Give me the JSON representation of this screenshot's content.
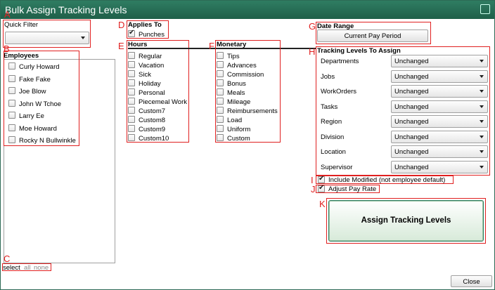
{
  "window": {
    "title": "Bulk Assign Tracking Levels"
  },
  "markers": {
    "A": "A",
    "B": "B",
    "C": "C",
    "D": "D",
    "E": "E",
    "F": "F",
    "G": "G",
    "H": "H",
    "I": "I",
    "J": "J",
    "K": "K"
  },
  "quick_filter": {
    "label": "Quick Filter",
    "value": ""
  },
  "employees": {
    "label": "Employees",
    "items": [
      "Curly Howard",
      "Fake Fake",
      "Joe Blow",
      "John W Tchoe",
      "Larry Ee",
      "Moe Howard",
      "Rocky N Bullwinkle"
    ]
  },
  "select_links": {
    "label": "select",
    "all": "all",
    "none": "none"
  },
  "applies_to": {
    "label": "Applies To",
    "punches": "Punches",
    "punches_checked": true
  },
  "hours": {
    "label": "Hours",
    "items": [
      "Regular",
      "Vacation",
      "Sick",
      "Holiday",
      "Personal",
      "Piecemeal Work",
      "Custom7",
      "Custom8",
      "Custom9",
      "Custom10"
    ]
  },
  "monetary": {
    "label": "Monetary",
    "items": [
      "Tips",
      "Advances",
      "Commission",
      "Bonus",
      "Meals",
      "Mileage",
      "Reimbursements",
      "Load",
      "Uniform",
      "Custom"
    ]
  },
  "date_range": {
    "label": "Date Range",
    "button": "Current Pay Period"
  },
  "tracking_levels": {
    "label": "Tracking Levels To Assign",
    "rows": [
      {
        "name": "Departments",
        "value": "Unchanged"
      },
      {
        "name": "Jobs",
        "value": "Unchanged"
      },
      {
        "name": "WorkOrders",
        "value": "Unchanged"
      },
      {
        "name": "Tasks",
        "value": "Unchanged"
      },
      {
        "name": "Region",
        "value": "Unchanged"
      },
      {
        "name": "Division",
        "value": "Unchanged"
      },
      {
        "name": "Location",
        "value": "Unchanged"
      },
      {
        "name": "Supervisor",
        "value": "Unchanged"
      }
    ]
  },
  "include_modified": {
    "label": "Include Modified (not employee default)",
    "checked": true
  },
  "adjust_pay_rate": {
    "label": "Adjust Pay Rate",
    "checked": true
  },
  "assign_button": "Assign Tracking Levels",
  "close_button": "Close",
  "colors": {
    "titlebar": "#2f7d62",
    "annotation": "#e02020"
  }
}
